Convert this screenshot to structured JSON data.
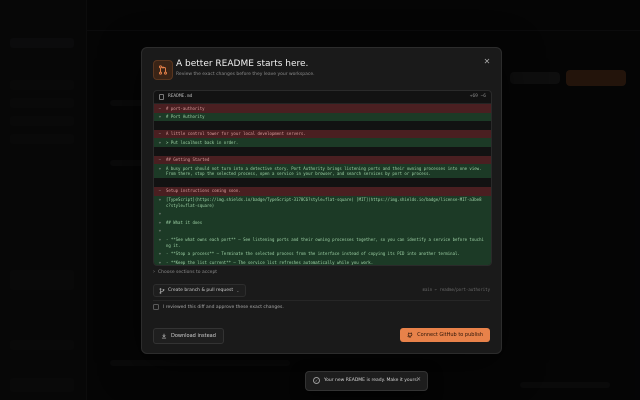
{
  "colors": {
    "accent": "#e8824a",
    "deleted_bg": "#4a1f21",
    "added_bg": "#1c3a26"
  },
  "modal": {
    "title": "A better README starts here.",
    "subtitle": "Review the exact changes before they leave your workspace.",
    "icon": "git-pull-request-icon",
    "close_icon": "close-icon"
  },
  "diff": {
    "file_name": "README.md",
    "stats": "+69 −6",
    "lines": [
      {
        "type": "del",
        "sign": "−",
        "text": "# port-authority"
      },
      {
        "type": "add",
        "sign": "+",
        "text": "# Port Authority"
      },
      {
        "type": "ctx",
        "sign": "",
        "text": ""
      },
      {
        "type": "del",
        "sign": "−",
        "text": "A little control tower for your local development servers."
      },
      {
        "type": "add",
        "sign": "+",
        "text": "> Put localhost back in order."
      },
      {
        "type": "ctx",
        "sign": "",
        "text": ""
      },
      {
        "type": "del",
        "sign": "−",
        "text": "## Getting Started"
      },
      {
        "type": "add",
        "sign": "+",
        "text": "A busy port should not turn into a detective story. Port Authority brings listening ports and their owning processes into one view. From there, stop the selected process, open a service in your browser, and search services by port or process."
      },
      {
        "type": "ctx",
        "sign": "",
        "text": ""
      },
      {
        "type": "del",
        "sign": "−",
        "text": "Setup instructions coming soon."
      },
      {
        "type": "add",
        "sign": "+",
        "text": "[TypeScript](https://img.shields.io/badge/TypeScript-3178C6?style=flat-square) [MIT](https://img.shields.io/badge/license-MIT-a3be8c?style=flat-square)"
      },
      {
        "type": "add",
        "sign": "+",
        "text": ""
      },
      {
        "type": "add",
        "sign": "+",
        "text": "## What it does"
      },
      {
        "type": "add",
        "sign": "+",
        "text": ""
      },
      {
        "type": "add",
        "sign": "+",
        "text": "- **See what owns each port** — See listening ports and their owning processes together, so you can identify a service before touching it."
      },
      {
        "type": "add",
        "sign": "+",
        "text": "- **Stop a process** — Terminate the selected process from the interface instead of copying its PID into another terminal."
      },
      {
        "type": "add",
        "sign": "+",
        "text": "- **Keep the list current** — The service list refreshes automatically while you work."
      }
    ]
  },
  "choose_sections": "Choose sections to accept",
  "branch_button": "Create branch & pull request",
  "branch_meta": "main ← readme/port-authority",
  "approve_checkbox": "I reviewed this diff and approve these exact changes.",
  "download_button": "Download instead",
  "connect_button": "Connect GitHub to publish",
  "toast": {
    "text": "Your new README is ready. Make it yours."
  }
}
